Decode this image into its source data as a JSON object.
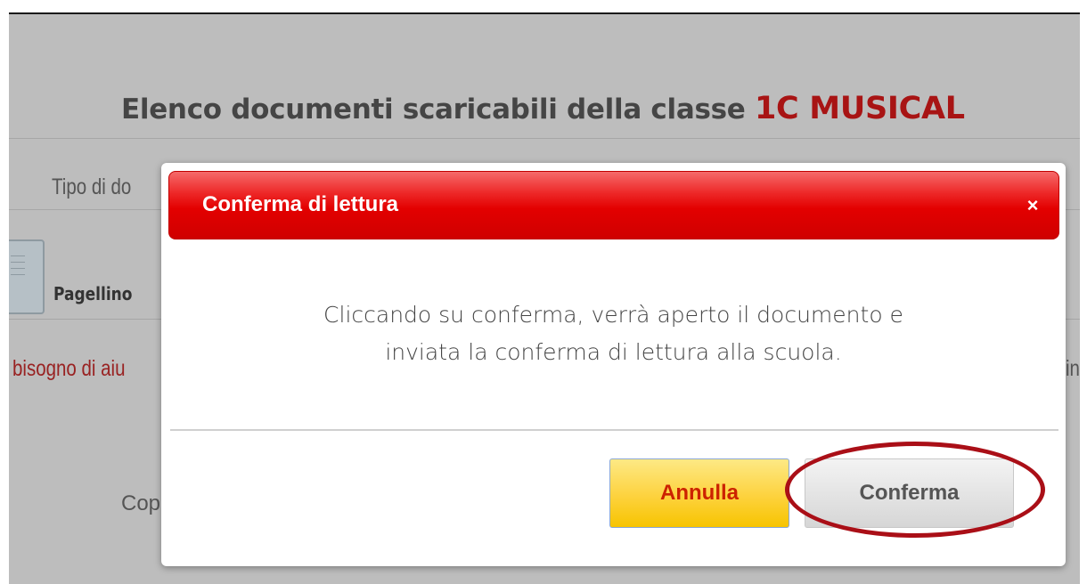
{
  "page": {
    "title_prefix": "Elenco documenti scaricabili della classe",
    "class_name": "1C MUSICAL",
    "column_header": "Tipo di do",
    "document_name": "Pagellino",
    "help_text": "bisogno di aiu",
    "help_text_right": "in",
    "copy_text": "Cop"
  },
  "dialog": {
    "title": "Conferma di lettura",
    "close_label": "×",
    "message_line1": "Cliccando su conferma, verrà aperto il documento e",
    "message_line2": "inviata la conferma di lettura alla scuola.",
    "cancel_label": "Annulla",
    "confirm_label": "Conferma"
  },
  "colors": {
    "header_red": "#e30000",
    "class_name_red": "#a81414",
    "cancel_yellow": "#fdd23d",
    "highlight_ring": "#aa0f17",
    "overlay_gray": "#bdbdbd"
  },
  "icons": {
    "close": "close-icon",
    "document": "document-icon"
  }
}
